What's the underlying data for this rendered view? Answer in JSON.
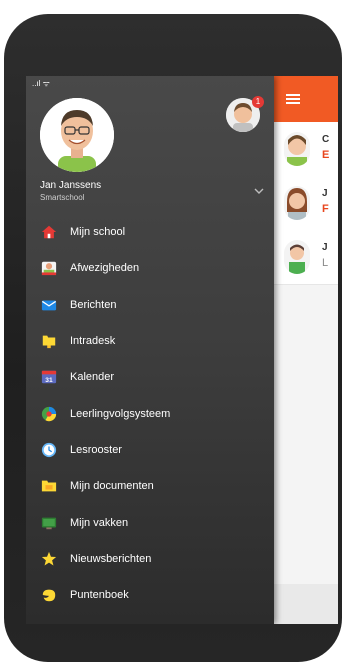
{
  "statusbar": {
    "signal": "..ıl ᯤ"
  },
  "profile": {
    "name": "Jan Janssens",
    "school": "Smartschool"
  },
  "badge_count": "1",
  "menu": [
    {
      "label": "Mijn school",
      "icon": "home-icon",
      "color": "#e53935"
    },
    {
      "label": "Afwezigheden",
      "icon": "absence-person-icon",
      "color": "#8bc34a"
    },
    {
      "label": "Berichten",
      "icon": "envelope-icon",
      "color": "#1e88e5"
    },
    {
      "label": "Intradesk",
      "icon": "folder-icon",
      "color": "#fdd835"
    },
    {
      "label": "Kalender",
      "icon": "calendar-icon",
      "color": "#5c6bc0"
    },
    {
      "label": "Leerlingvolgsysteem",
      "icon": "chart-circle-icon",
      "color": "#43a047"
    },
    {
      "label": "Lesrooster",
      "icon": "clock-icon",
      "color": "#64b5f6"
    },
    {
      "label": "Mijn documenten",
      "icon": "documents-folder-icon",
      "color": "#fdd835"
    },
    {
      "label": "Mijn vakken",
      "icon": "courses-board-icon",
      "color": "#43a047"
    },
    {
      "label": "Nieuwsberichten",
      "icon": "star-icon",
      "color": "#fdd835"
    },
    {
      "label": "Puntenboek",
      "icon": "gradebook-icon",
      "color": "#fdd835"
    },
    {
      "label": "",
      "icon": "partial-icon",
      "color": "#e53935"
    }
  ],
  "messages": [
    {
      "title": "C",
      "subtitle": "E",
      "subtitle_style": "red"
    },
    {
      "title": "J",
      "subtitle": "F",
      "subtitle_style": "red"
    },
    {
      "title": "J",
      "subtitle": "L",
      "subtitle_style": "grey"
    }
  ],
  "calendar_day": "31"
}
